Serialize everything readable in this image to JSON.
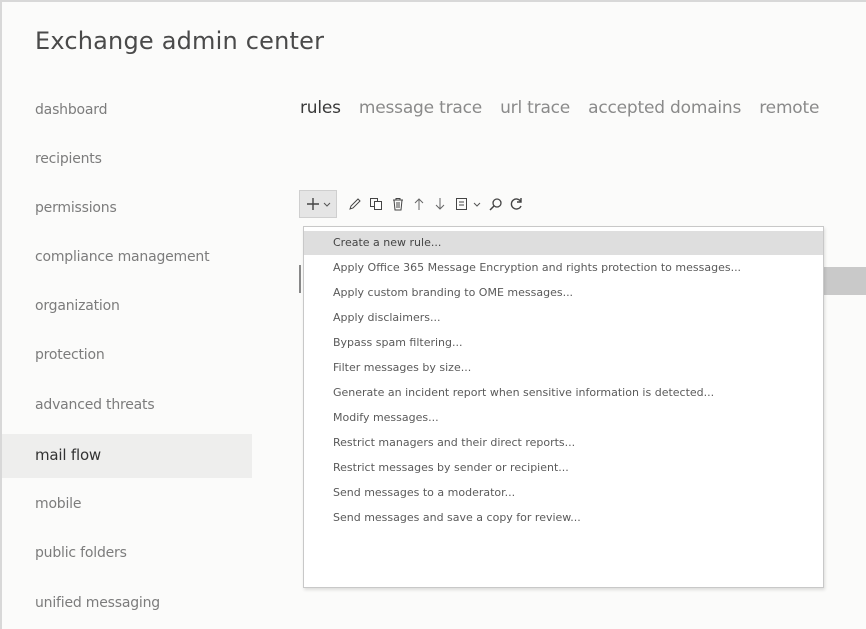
{
  "app": {
    "title": "Exchange admin center"
  },
  "sidebar": {
    "items": [
      {
        "label": "dashboard"
      },
      {
        "label": "recipients"
      },
      {
        "label": "permissions"
      },
      {
        "label": "compliance management"
      },
      {
        "label": "organization"
      },
      {
        "label": "protection"
      },
      {
        "label": "advanced threats"
      },
      {
        "label": "mail flow",
        "active": true
      },
      {
        "label": "mobile"
      },
      {
        "label": "public folders"
      },
      {
        "label": "unified messaging"
      }
    ]
  },
  "tabs": [
    {
      "label": "rules",
      "active": true
    },
    {
      "label": "message trace"
    },
    {
      "label": "url trace"
    },
    {
      "label": "accepted domains"
    },
    {
      "label": "remote"
    }
  ],
  "toolbar": {
    "icons": [
      "add-icon",
      "chevron-down-icon",
      "edit-icon",
      "copy-icon",
      "delete-icon",
      "move-up-icon",
      "move-down-icon",
      "export-icon",
      "chevron-down-icon",
      "search-icon",
      "refresh-icon"
    ]
  },
  "menu": {
    "items": [
      {
        "label": "Create a new rule..."
      },
      {
        "label": "Apply Office 365 Message Encryption and rights protection to messages..."
      },
      {
        "label": "Apply custom branding to OME messages..."
      },
      {
        "label": "Apply disclaimers..."
      },
      {
        "label": "Bypass spam filtering..."
      },
      {
        "label": "Filter messages by size..."
      },
      {
        "label": "Generate an incident report when sensitive information is detected..."
      },
      {
        "label": "Modify messages..."
      },
      {
        "label": "Restrict managers and their direct reports..."
      },
      {
        "label": "Restrict messages by sender or recipient..."
      },
      {
        "label": "Send messages to a moderator..."
      },
      {
        "label": "Send messages and save a copy for review..."
      }
    ]
  }
}
